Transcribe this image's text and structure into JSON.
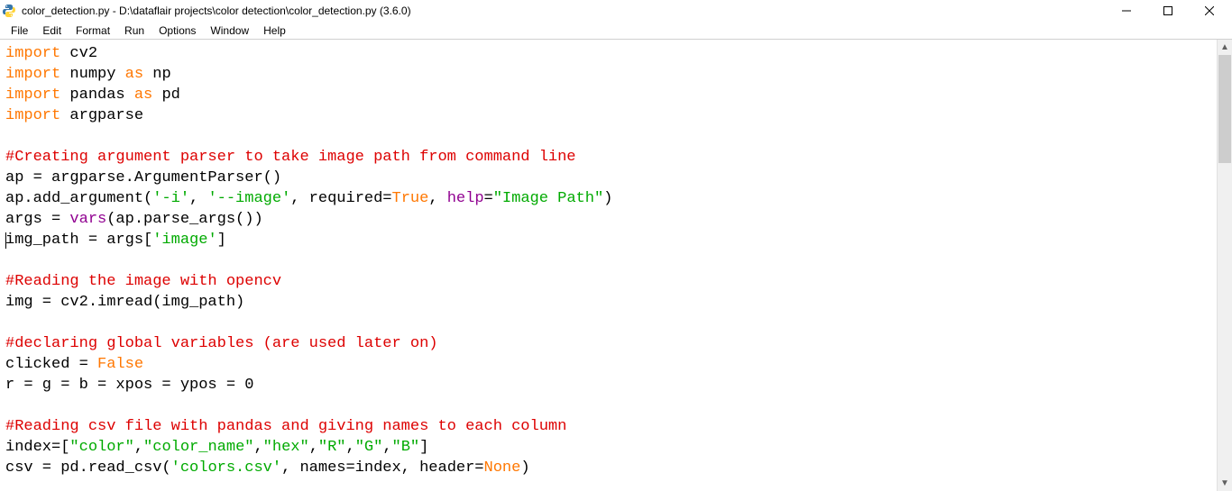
{
  "window": {
    "title": "color_detection.py - D:\\dataflair projects\\color detection\\color_detection.py (3.6.0)"
  },
  "menu": {
    "items": [
      "File",
      "Edit",
      "Format",
      "Run",
      "Options",
      "Window",
      "Help"
    ]
  },
  "code": {
    "lines": [
      [
        {
          "c": "kw-orange",
          "t": "import"
        },
        {
          "t": " cv2"
        }
      ],
      [
        {
          "c": "kw-orange",
          "t": "import"
        },
        {
          "t": " numpy "
        },
        {
          "c": "kw-orange",
          "t": "as"
        },
        {
          "t": " np"
        }
      ],
      [
        {
          "c": "kw-orange",
          "t": "import"
        },
        {
          "t": " pandas "
        },
        {
          "c": "kw-orange",
          "t": "as"
        },
        {
          "t": " pd"
        }
      ],
      [
        {
          "c": "kw-orange",
          "t": "import"
        },
        {
          "t": " argparse"
        }
      ],
      [],
      [
        {
          "c": "comment",
          "t": "#Creating argument parser to take image path from command line"
        }
      ],
      [
        {
          "t": "ap = argparse.ArgumentParser()"
        }
      ],
      [
        {
          "t": "ap.add_argument("
        },
        {
          "c": "string",
          "t": "'-i'"
        },
        {
          "t": ", "
        },
        {
          "c": "string",
          "t": "'--image'"
        },
        {
          "t": ", required="
        },
        {
          "c": "kw-orange",
          "t": "True"
        },
        {
          "t": ", "
        },
        {
          "c": "purple",
          "t": "help"
        },
        {
          "t": "="
        },
        {
          "c": "string",
          "t": "\"Image Path\""
        },
        {
          "t": ")"
        }
      ],
      [
        {
          "t": "args = "
        },
        {
          "c": "purple",
          "t": "vars"
        },
        {
          "t": "(ap.parse_args())"
        }
      ],
      [
        {
          "caret": true
        },
        {
          "t": "img_path = args["
        },
        {
          "c": "string",
          "t": "'image'"
        },
        {
          "t": "]"
        }
      ],
      [],
      [
        {
          "c": "comment",
          "t": "#Reading the image with opencv"
        }
      ],
      [
        {
          "t": "img = cv2.imread(img_path)"
        }
      ],
      [],
      [
        {
          "c": "comment",
          "t": "#declaring global variables (are used later on)"
        }
      ],
      [
        {
          "t": "clicked = "
        },
        {
          "c": "kw-orange",
          "t": "False"
        }
      ],
      [
        {
          "t": "r = g = b = xpos = ypos = 0"
        }
      ],
      [],
      [
        {
          "c": "comment",
          "t": "#Reading csv file with pandas and giving names to each column"
        }
      ],
      [
        {
          "t": "index=["
        },
        {
          "c": "string",
          "t": "\"color\""
        },
        {
          "t": ","
        },
        {
          "c": "string",
          "t": "\"color_name\""
        },
        {
          "t": ","
        },
        {
          "c": "string",
          "t": "\"hex\""
        },
        {
          "t": ","
        },
        {
          "c": "string",
          "t": "\"R\""
        },
        {
          "t": ","
        },
        {
          "c": "string",
          "t": "\"G\""
        },
        {
          "t": ","
        },
        {
          "c": "string",
          "t": "\"B\""
        },
        {
          "t": "]"
        }
      ],
      [
        {
          "t": "csv = pd.read_csv("
        },
        {
          "c": "string",
          "t": "'colors.csv'"
        },
        {
          "t": ", names=index, header="
        },
        {
          "c": "kw-orange",
          "t": "None"
        },
        {
          "t": ")"
        }
      ]
    ]
  }
}
